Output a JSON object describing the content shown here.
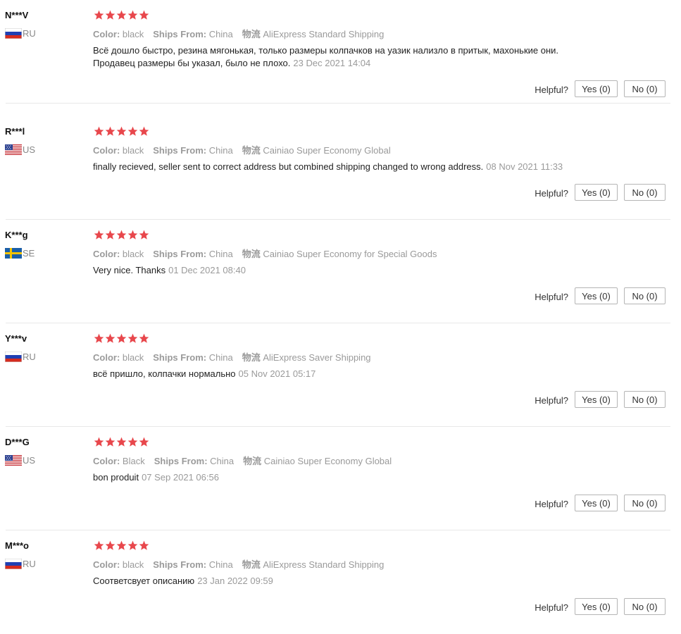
{
  "colors": {
    "star": "#e8474c",
    "muted": "#9a9a9a",
    "separator": "#e8e8e8"
  },
  "labels": {
    "color": "Color:",
    "ships_from": "Ships From:",
    "logistics": "物流",
    "helpful": "Helpful?"
  },
  "reviews": [
    {
      "user": "N***V",
      "country": "RU",
      "flag": "ru",
      "rating": 5,
      "color": "black",
      "ships_from": "China",
      "shipping": "AliExpress Standard Shipping",
      "text_line1": "Всё дошло быстро, резина мягонькая, только размеры колпачков на уазик нализло в притык, махонькие они.",
      "text_line2": "Продавец размеры бы указал, было не плохо.",
      "date": "23 Dec 2021 14:04",
      "yes": "Yes (0)",
      "no": "No (0)"
    },
    {
      "user": "R***l",
      "country": "US",
      "flag": "us",
      "rating": 5,
      "color": "black",
      "ships_from": "China",
      "shipping": "Cainiao Super Economy Global",
      "text_line1": "finally recieved, seller sent to correct address but combined shipping changed to wrong address.",
      "text_line2": "",
      "date": "08 Nov 2021 11:33",
      "yes": "Yes (0)",
      "no": "No (0)"
    },
    {
      "user": "K***g",
      "country": "SE",
      "flag": "se",
      "rating": 5,
      "color": "black",
      "ships_from": "China",
      "shipping": "Cainiao Super Economy for Special Goods",
      "text_line1": "Very nice. Thanks",
      "text_line2": "",
      "date": "01 Dec 2021 08:40",
      "yes": "Yes (0)",
      "no": "No (0)"
    },
    {
      "user": "Y***v",
      "country": "RU",
      "flag": "ru",
      "rating": 5,
      "color": "black",
      "ships_from": "China",
      "shipping": "AliExpress Saver Shipping",
      "text_line1": "всё пришло, колпачки нормально",
      "text_line2": "",
      "date": "05 Nov 2021 05:17",
      "yes": "Yes (0)",
      "no": "No (0)"
    },
    {
      "user": "D***G",
      "country": "US",
      "flag": "us",
      "rating": 5,
      "color": "Black",
      "ships_from": "China",
      "shipping": "Cainiao Super Economy Global",
      "text_line1": "bon produit",
      "text_line2": "",
      "date": "07 Sep 2021 06:56",
      "yes": "Yes (0)",
      "no": "No (0)"
    },
    {
      "user": "M***o",
      "country": "RU",
      "flag": "ru",
      "rating": 5,
      "color": "black",
      "ships_from": "China",
      "shipping": "AliExpress Standard Shipping",
      "text_line1": "Соответсвует описанию",
      "text_line2": "",
      "date": "23 Jan 2022 09:59",
      "yes": "Yes (0)",
      "no": "No (0)"
    }
  ]
}
